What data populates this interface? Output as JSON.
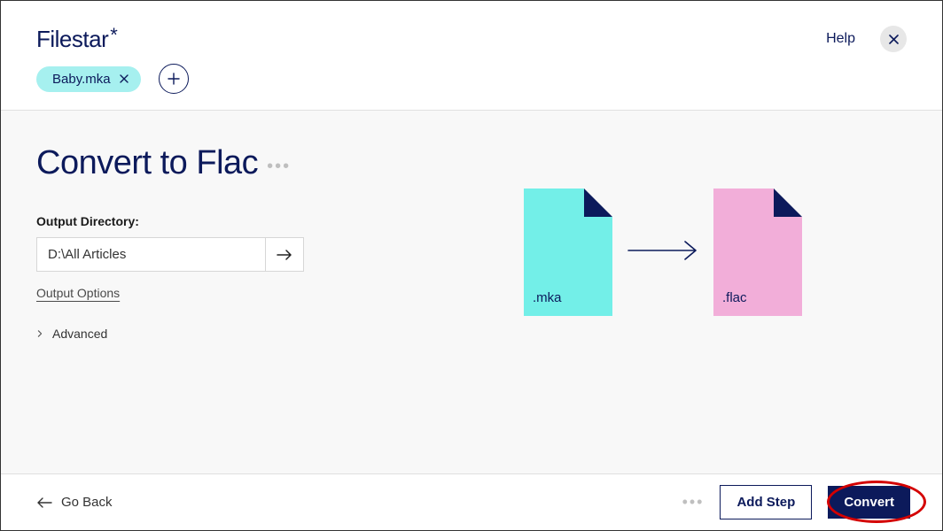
{
  "header": {
    "brand": "Filestar",
    "brand_suffix": "*",
    "help": "Help"
  },
  "files": {
    "0": {
      "name": "Baby.mka"
    }
  },
  "main": {
    "title": "Convert to Flac",
    "output_label": "Output Directory:",
    "output_path": "D:\\All Articles",
    "output_options": "Output Options",
    "advanced": "Advanced"
  },
  "illustration": {
    "from_ext": ".mka",
    "to_ext": ".flac"
  },
  "footer": {
    "go_back": "Go Back",
    "add_step": "Add Step",
    "convert": "Convert"
  }
}
